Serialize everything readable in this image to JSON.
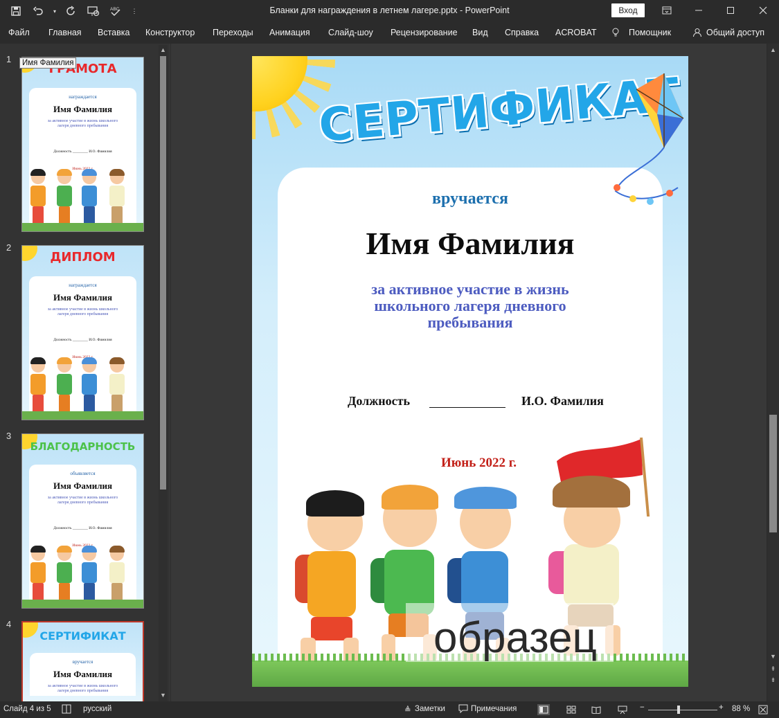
{
  "titlebar": {
    "doc_title": "Бланки для награждения в летнем лагере.pptx  -  PowerPoint",
    "signin": "Вход"
  },
  "menu": [
    "Файл",
    "Главная",
    "Вставка",
    "Конструктор",
    "Переходы",
    "Анимация",
    "Слайд-шоу",
    "Рецензирование",
    "Вид",
    "Справка",
    "ACROBAT",
    "Помощник",
    "Общий доступ"
  ],
  "tooltip": "Имя Фамилия",
  "thumbnails": [
    {
      "num": "1",
      "head": "ГРАМОТА",
      "head_color": "#e8282b",
      "sub": "награждается",
      "name": "Имя Фамилия",
      "desc": "за активное участие в жизнь школьного лагеря дневного пребывания",
      "sig": "Должность ________   И.О. Фамилия",
      "date": "Июнь 2022 г."
    },
    {
      "num": "2",
      "head": "ДИПЛОМ",
      "head_color": "#e8282b",
      "sub": "награждается",
      "name": "Имя Фамилия",
      "desc": "за активное участие в жизнь школьного лагеря дневного пребывания",
      "sig": "Должность ________   И.О. Фамилия",
      "date": "Июнь 2022 г."
    },
    {
      "num": "3",
      "head": "БЛАГОДАРНОСТЬ",
      "head_color": "#4cc24a",
      "sub": "объявляется",
      "name": "Имя Фамилия",
      "desc": "за активное участие в жизнь школьного лагеря дневного пребывания",
      "sig": "Должность ________   И.О. Фамилия",
      "date": "Июнь 2022 г."
    },
    {
      "num": "4",
      "head": "СЕРТИФИКАТ",
      "head_color": "#23a6e8",
      "sub": "вручается",
      "name": "Имя Фамилия",
      "desc": "за активное участие в жизнь школьного лагеря дневного пребывания",
      "sig": "",
      "date": ""
    }
  ],
  "slide": {
    "title": "СЕРТИФИКАТ",
    "award": "вручается",
    "name": "Имя Фамилия",
    "desc": "за активное участие в жизнь школьного лагеря дневного пребывания",
    "position": "Должность",
    "signer": "И.О. Фамилия",
    "date": "Июнь 2022 г.",
    "watermark": "образец"
  },
  "status": {
    "slide": "Слайд 4 из 5",
    "language": "русский",
    "notes": "Заметки",
    "comments": "Примечания",
    "zoom": "88 %"
  },
  "colors": {
    "accent_blue": "#23a6e8",
    "date_red": "#c21f17",
    "desc_blue": "#4d5cc0"
  }
}
